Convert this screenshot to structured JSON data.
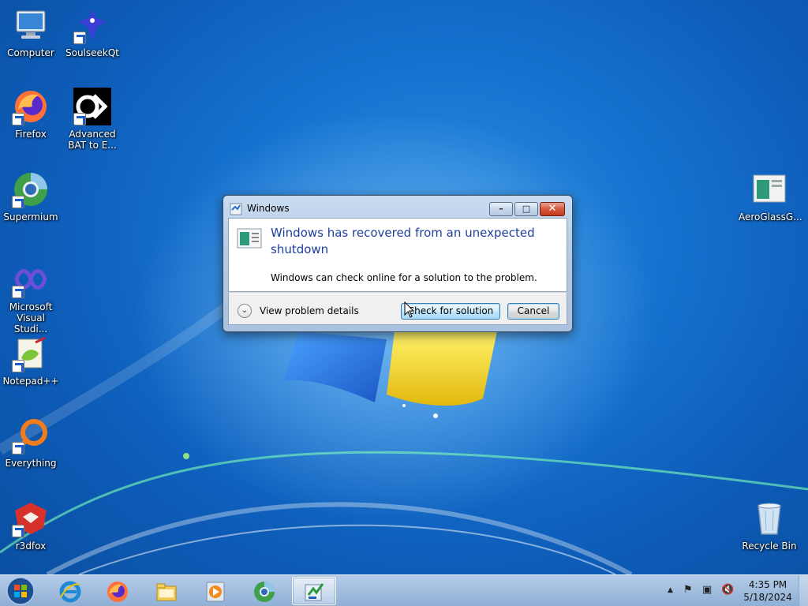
{
  "desktop": {
    "icons_left": [
      {
        "label": "Computer"
      },
      {
        "label": "Firefox"
      },
      {
        "label": "Supermium"
      },
      {
        "label": "Microsoft Visual Studi..."
      },
      {
        "label": "Notepad++"
      },
      {
        "label": "Everything"
      },
      {
        "label": "r3dfox"
      }
    ],
    "icons_col2": [
      {
        "label": "SoulseekQt"
      },
      {
        "label": "Advanced BAT to E..."
      }
    ],
    "icons_right": [
      {
        "label": "AeroGlassG..."
      },
      {
        "label": "Recycle Bin"
      }
    ]
  },
  "dialog": {
    "title": "Windows",
    "headline": "Windows has recovered from an unexpected shutdown",
    "message": "Windows can check online for a solution to the problem.",
    "details_label": "View problem details",
    "primary_button": "Check for solution",
    "cancel_button": "Cancel",
    "minimize_glyph": "–",
    "maximize_glyph": "□",
    "close_glyph": "✕",
    "details_glyph": "⌄"
  },
  "taskbar": {
    "pinned": [
      "start-orb-icon",
      "internet-explorer-icon",
      "firefox-icon",
      "file-explorer-icon",
      "media-player-icon",
      "supermium-icon",
      "windows-error-reporting-icon"
    ],
    "tray": {
      "chevron": "▲",
      "flag": "⚑",
      "network": "▣",
      "volume": "🔇"
    },
    "time": "4:35 PM",
    "date": "5/18/2024"
  }
}
